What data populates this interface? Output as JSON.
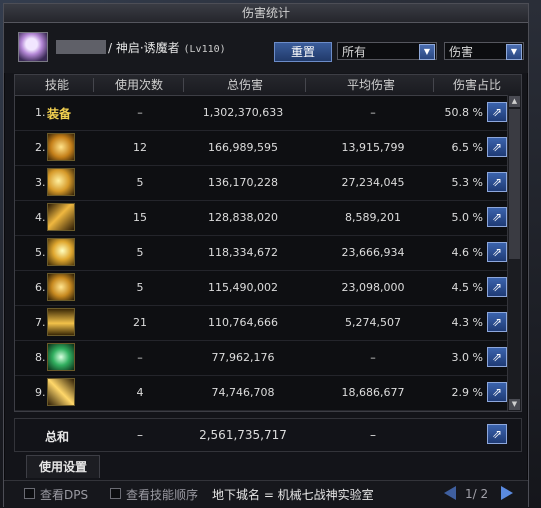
{
  "window": {
    "title": "伤害统计"
  },
  "character": {
    "name": "/ 神启·诱魔者",
    "level": "(Lv110)"
  },
  "controls": {
    "reset_label": "重置",
    "filter_value": "所有",
    "metric_value": "伤害"
  },
  "columns": {
    "skill": "技能",
    "uses": "使用次数",
    "total": "总伤害",
    "avg": "平均伤害",
    "share": "伤害占比"
  },
  "rows": [
    {
      "idx": "1.",
      "skill": "装备",
      "uses": "–",
      "total": "1,302,370,633",
      "avg": "–",
      "pct": "50.8 %",
      "icon": "equipment"
    },
    {
      "idx": "2.",
      "skill": "",
      "uses": "12",
      "total": "166,989,595",
      "avg": "13,915,799",
      "pct": "6.5 %",
      "icon": "skill-icon-2"
    },
    {
      "idx": "3.",
      "skill": "",
      "uses": "5",
      "total": "136,170,228",
      "avg": "27,234,045",
      "pct": "5.3 %",
      "icon": "skill-icon-3"
    },
    {
      "idx": "4.",
      "skill": "",
      "uses": "15",
      "total": "128,838,020",
      "avg": "8,589,201",
      "pct": "5.0 %",
      "icon": "skill-icon-4"
    },
    {
      "idx": "5.",
      "skill": "",
      "uses": "5",
      "total": "118,334,672",
      "avg": "23,666,934",
      "pct": "4.6 %",
      "icon": "skill-icon-5"
    },
    {
      "idx": "6.",
      "skill": "",
      "uses": "5",
      "total": "115,490,002",
      "avg": "23,098,000",
      "pct": "4.5 %",
      "icon": "skill-icon-6"
    },
    {
      "idx": "7.",
      "skill": "",
      "uses": "21",
      "total": "110,764,666",
      "avg": "5,274,507",
      "pct": "4.3 %",
      "icon": "skill-icon-7"
    },
    {
      "idx": "8.",
      "skill": "",
      "uses": "–",
      "total": "77,962,176",
      "avg": "–",
      "pct": "3.0 %",
      "icon": "skill-icon-8"
    },
    {
      "idx": "9.",
      "skill": "",
      "uses": "4",
      "total": "74,746,708",
      "avg": "18,686,677",
      "pct": "2.9 %",
      "icon": "skill-icon-9"
    }
  ],
  "totals": {
    "label": "总和",
    "uses": "–",
    "total": "2,561,735,717",
    "avg": "–"
  },
  "settings_tab": "使用设置",
  "footer": {
    "show_dps": "查看DPS",
    "show_order": "查看技能顺序",
    "dungeon": "地下城名 = 机械七战神实验室",
    "page": "1/ 2"
  },
  "colors": {
    "accent": "#3b63ad",
    "gold": "#f3d150"
  }
}
